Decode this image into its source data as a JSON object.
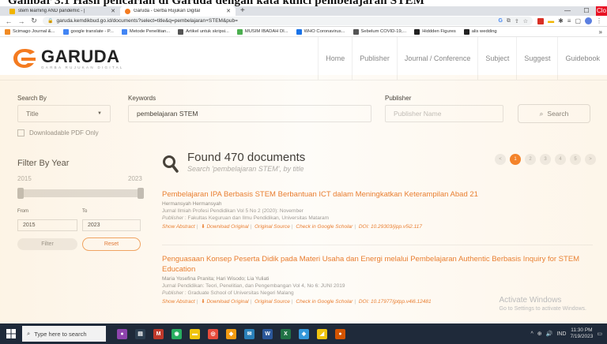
{
  "banner": {
    "text": "Gambar 3.1 Hasil pencarian di Garuda dengan kata kunci pembelajaran STEM"
  },
  "browser": {
    "tabs": [
      {
        "label": "stem learning AND pandemic - |",
        "icon": "doc-icon",
        "active": false
      },
      {
        "label": "Garuda - Gerba Rujukan Digital",
        "icon": "garuda-icon",
        "active": true
      }
    ],
    "new_tab": "+",
    "window": {
      "minimize": "—",
      "maximize": "☐",
      "close": "✕",
      "close_label": "Clo"
    },
    "url": "garuda.kemdikbud.go.id/documents?select=title&q=pembelajaran+STEM&pub=",
    "bookmarks": [
      {
        "label": "Scimago Journal &...",
        "color": "#f08a24"
      },
      {
        "label": "google translate - P...",
        "color": "#4285f4"
      },
      {
        "label": "Metode Penelitian...",
        "color": "#4285f4"
      },
      {
        "label": "Artikel untuk skripsi...",
        "color": "#555555"
      },
      {
        "label": "MUSIM IBADAH DI...",
        "color": "#4caf50"
      },
      {
        "label": "WHO Coronavirus...",
        "color": "#1a73e8"
      },
      {
        "label": "Sebelum COVID-19,...",
        "color": "#555555"
      },
      {
        "label": "Hiddden Figures",
        "color": "#222222"
      },
      {
        "label": "alis wedding",
        "color": "#222222"
      }
    ],
    "more": "»"
  },
  "site": {
    "logo_title": "GARUDA",
    "logo_sub": "GARBA RUJUKAN DIGITAL",
    "accent": "#f47b20",
    "nav": [
      "Home",
      "Publisher",
      "Journal / Conference",
      "Subject",
      "Suggest",
      "Guidebook"
    ]
  },
  "search": {
    "search_by_label": "Search By",
    "search_by_value": "Title",
    "keywords_label": "Keywords",
    "keywords_value": "pembelajaran STEM",
    "publisher_label": "Publisher",
    "publisher_placeholder": "Publisher Name",
    "search_button": "Search",
    "pdf_only_label": "Downloadable PDF Only"
  },
  "filter": {
    "title": "Filter By Year",
    "range_start": "2015",
    "range_end": "2023",
    "from_label": "From",
    "to_label": "To",
    "from_value": "2015",
    "to_value": "2023",
    "filter_button": "Filter",
    "reset_button": "Reset"
  },
  "results": {
    "found": "Found 470 documents",
    "subtitle": "Search 'pembelajaran STEM', by title",
    "pager": [
      "<",
      "1",
      "2",
      "3",
      "4",
      "5",
      ">"
    ],
    "items": [
      {
        "title": "Pembelajaran IPA Berbasis STEM Berbantuan ICT dalam Meningkatkan Keterampilan Abad 21",
        "authors": "Hermansyah Hermansyah",
        "journal": "Jurnal Ilmiah Profesi Pendidikan Vol 5 No 2 (2020): November",
        "publisher_label": "Publisher",
        "publisher": " : Fakultas Keguruan dan Ilmu Pendidikan, Universitas Mataram",
        "links": [
          "Show Abstract",
          "Download Original",
          "Original Source",
          "Check in Google Scholar",
          "DOI: 10.29303/jipp.v5i2.117"
        ]
      },
      {
        "title": "Penguasaan Konsep Peserta Didik pada Materi Usaha dan Energi melalui Pembelajaran Authentic Berbasis Inquiry for STEM Education",
        "authors": "Maria Yosefina Pranita; Hari Wisodo; Lia Yuliati",
        "journal": "Jurnal Pendidikan: Teori, Penelitian, dan Pengembangan Vol 4, No 6: JUNI 2019",
        "publisher_label": "Publisher",
        "publisher": " : Graduate School of Universitas Negeri Malang",
        "links": [
          "Show Abstract",
          "Download Original",
          "Original Source",
          "Check in Google Scholar",
          "DOI: 10.17977/jptpp.v4i6.12481"
        ]
      }
    ]
  },
  "watermark": {
    "title": "Activate Windows",
    "sub": "Go to Settings to activate Windows."
  },
  "taskbar": {
    "search_placeholder": "Type here to search",
    "lang": "IND",
    "time": "11:30 PM",
    "date": "7/19/2023"
  }
}
